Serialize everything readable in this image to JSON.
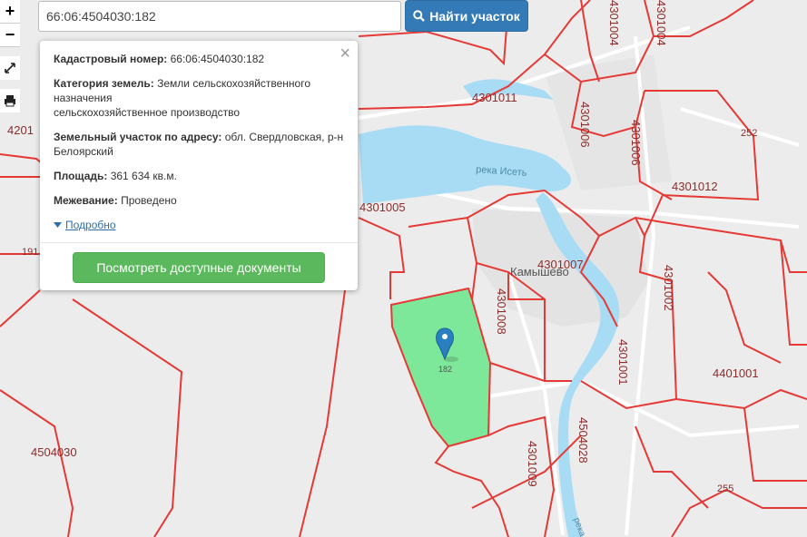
{
  "search": {
    "value": "66:06:4504030:182",
    "button_label": "Найти участок"
  },
  "controls": {
    "zoom_in": "+",
    "zoom_out": "−"
  },
  "popup": {
    "cad_label": "Кадастровый номер:",
    "cad_value": "66:06:4504030:182",
    "cat_label": "Категория земель:",
    "cat_value": "Земли сельскохозяйственного назначения",
    "cat_value2": "сельскохозяйственное производство",
    "addr_label": "Земельный участок по адресу:",
    "addr_value": "обл. Свердловская, р-н Белоярский",
    "area_label": "Площадь:",
    "area_value": "361 634 кв.м.",
    "survey_label": "Межевание:",
    "survey_value": "Проведено",
    "more_link": "Подробно",
    "docs_button": "Посмотреть доступные документы"
  },
  "map": {
    "place_name": "Камышево",
    "river_name": "река Исеть",
    "river_name2": "река",
    "parcel_label": "182",
    "labels": {
      "q4301011": "4301011",
      "q4301005": "4301005",
      "q4301006": "4301006",
      "q4301004": "4301004",
      "q4301012": "4301012",
      "q4301007": "4301007",
      "q4301008": "4301008",
      "q4301002": "4301002",
      "q4301001": "4301001",
      "q4401001": "4401001",
      "q4504028": "4504028",
      "q4301009": "4301009",
      "q4504030": "4504030",
      "q4201": "4201",
      "n191": "191",
      "n252": "252",
      "n255": "255"
    }
  },
  "colors": {
    "boundary": "#e53935",
    "parcel_fill": "#7ee89a",
    "river": "#a8dcf5",
    "pin": "#2a7fc1"
  }
}
